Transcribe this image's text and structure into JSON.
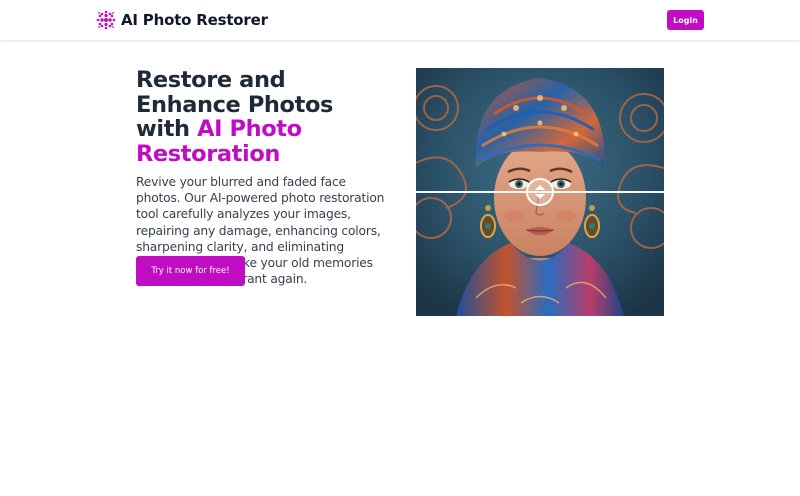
{
  "header": {
    "brand_name": "AI Photo Restorer",
    "brand_icon": "dot-grid-logo-icon",
    "login_label": "Login"
  },
  "hero": {
    "title_main": "Restore and Enhance Photos with ",
    "title_accent": "AI Photo Restoration",
    "description": "Revive your blurred and faded face photos. Our AI-powered photo restoration tool carefully analyzes your images, repairing any damage, enhancing colors, sharpening clarity, and eliminating imperfections. Make your old memories look fresh and vibrant again.",
    "cta_label": "Try it now for free!"
  },
  "compare": {
    "handle_icon": "up-down-arrows-icon",
    "image_subject": "woman with colorful head wrap"
  },
  "colors": {
    "accent": "#c00dc4",
    "text_dark": "#1f2937"
  }
}
